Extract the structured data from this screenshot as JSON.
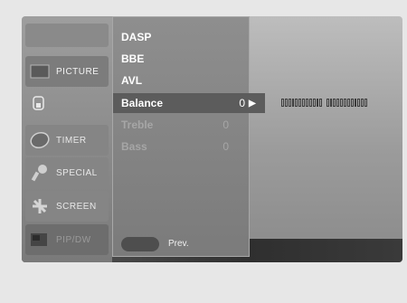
{
  "side_menu": {
    "items": [
      {
        "label": "PICTURE",
        "icon": "picture-icon",
        "state": "active"
      },
      {
        "label": "",
        "icon": "audio-icon",
        "state": "normal"
      },
      {
        "label": "TIMER",
        "icon": "timer-icon",
        "state": "normal"
      },
      {
        "label": "SPECIAL",
        "icon": "special-icon",
        "state": "normal"
      },
      {
        "label": "SCREEN",
        "icon": "screen-icon",
        "state": "normal"
      },
      {
        "label": "PIP/DW",
        "icon": "pip-icon",
        "state": "dim"
      }
    ]
  },
  "audio_menu": {
    "items": [
      {
        "label": "DASP",
        "value": "",
        "state": "on"
      },
      {
        "label": "BBE",
        "value": "",
        "state": "on"
      },
      {
        "label": "AVL",
        "value": "",
        "state": "on"
      },
      {
        "label": "Balance",
        "value": "0",
        "state": "selected"
      },
      {
        "label": "Treble",
        "value": "0",
        "state": "off"
      },
      {
        "label": "Bass",
        "value": "0",
        "state": "off"
      }
    ],
    "selected_arrow": "▶"
  },
  "footer": {
    "prev_label": "Prev."
  },
  "balance": {
    "value": 0
  },
  "colors": {
    "menu_bg": "#8e8e8e",
    "selected_bg": "#5c5c5c",
    "text_active": "#ffffff",
    "text_inactive": "#a6a6a6"
  }
}
